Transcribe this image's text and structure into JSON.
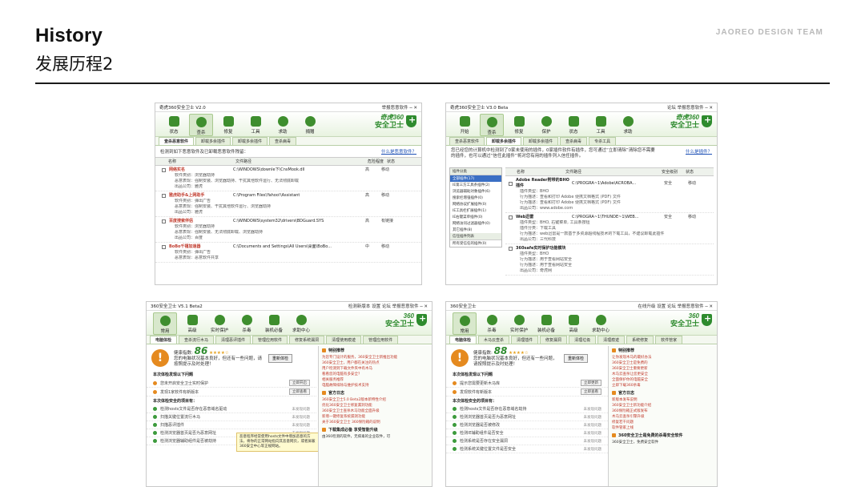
{
  "slide": {
    "title": "History",
    "subtitle": "发展历程2",
    "brand": "JAOREO DESIGN TEAM"
  },
  "colors": {
    "accent_green": "#2e8b2e",
    "warning_orange": "#e58a1f",
    "link_blue": "#1c4fb5",
    "alert_red": "#c0392b"
  },
  "shots": [
    {
      "window_title": "奇虎360安全卫士 V2.0",
      "window_controls": "举报恶意软件 ─ ✕",
      "toolbar": [
        {
          "label": "状态",
          "icon": "monitor-icon"
        },
        {
          "label": "查杀",
          "icon": "magnifier-icon"
        },
        {
          "label": "修复",
          "icon": "plus-box-icon"
        },
        {
          "label": "工具",
          "icon": "tools-icon"
        },
        {
          "label": "求助",
          "icon": "help-icon"
        },
        {
          "label": "捐赠",
          "icon": "gift-icon"
        }
      ],
      "logo_line1": "奇虎360",
      "logo_line2": "安全卫士",
      "tabs": [
        "查杀恶意软件",
        "卸载多余插件",
        "卸载多余插件",
        "查杀病毒"
      ],
      "info": "检测到如下恶意软件及已卸载恶意软件残留：",
      "info_link": "什么是恶意软件？",
      "columns": [
        "名称",
        "文件路径",
        "危险程度",
        "状态"
      ],
      "rows": [
        {
          "name": "网络实名",
          "path": "C:\\WINDOWS\\downle下\\CnsMook.dll",
          "lvl": "高",
          "st": "移动",
          "details": [
            "软件类别：浏览器劫持",
            "恶意表现：强制安装、浏览器劫持、干扰其他软件运行、无法彻底卸载",
            "出品公司：雅虎"
          ]
        },
        {
          "name": "雅虎助手&上网助手",
          "path": "C:\\Program Files\\Yahoo!\\Assistant",
          "lvl": "高",
          "st": "移动",
          "details": [
            "软件类别：弹出广告",
            "恶意表现：强制安装、干扰其他软件运行、浏览器劫持",
            "出品公司：雅虎"
          ]
        },
        {
          "name": "百度搜索伴侣",
          "path": "C:\\WINDOWS\\system32\\drivers\\BDGuard.SYS",
          "lvl": "高",
          "st": "有链接",
          "details": [
            "软件类别：浏览器劫持",
            "恶意表现：强制安装、无法彻底卸载、浏览器劫持",
            "出品公司：百度"
          ]
        },
        {
          "name": "BoBo千禧加速器",
          "path": "C:\\Documents and Settings\\All Users\\桌面\\BoBo...",
          "lvl": "中",
          "st": "移动",
          "details": [
            "软件类别：弹出广告",
            "恶意表现：恶意软件共享"
          ]
        }
      ]
    },
    {
      "window_title": "奇虎360安全卫士 V3.0 Beta",
      "window_controls": "论坛 举报恶意软件 ─ ✕",
      "toolbar": [
        {
          "label": "开始",
          "icon": "play-icon"
        },
        {
          "label": "查杀",
          "icon": "magnifier-icon"
        },
        {
          "label": "修复",
          "icon": "plus-box-icon"
        },
        {
          "label": "保护",
          "icon": "shield-icon"
        },
        {
          "label": "状态",
          "icon": "monitor-icon"
        },
        {
          "label": "工具",
          "icon": "tools-icon"
        },
        {
          "label": "求助",
          "icon": "help-icon"
        }
      ],
      "logo_line1": "奇虎360",
      "logo_line2": "安全卫士",
      "tabs": [
        "查杀恶意软件",
        "卸载多余插件",
        "卸载多余插件",
        "查杀病毒",
        "专杀工具"
      ],
      "info": "您已经您的计算机中检测到了0家未使用的插件，0家插件软件有插件，您可通过“立即清除”清除您不需要的插件，也可以通过“信任此插件”将对您有用的插件列入信任插件。",
      "info_link": "什么是插件？",
      "category_header": "插件分类",
      "categories": [
        "全部插件(17)",
        "IE第三方工具条插件(2)",
        "浏览器辅助对象插件(6)",
        "搜索栏增强插件(0)",
        "网络协议扩展插件(0)",
        "IE工具栏扩展插件(1)",
        "IE右键菜单插件(0)",
        "网络访问过滤器插件(0)",
        "其它插件(8)"
      ],
      "category_header2": "信任插件列表",
      "categories2": [
        "所有受信任的插件(0)"
      ],
      "columns": [
        "名称",
        "文件路径",
        "安全级别",
        "状态"
      ],
      "rows": [
        {
          "name": "Adobe Reader附带的BHO插件",
          "path": "C:\\PROGRA~1\\Adobe\\ACROBA...",
          "lvl": "安全",
          "st": "移动",
          "details": [
            "插件类型：BHO",
            "行为描述：查看和打印 Adobe 便携文档格式 (PDF) 文件",
            "行为描述：查看和打印 Adobe 便携文档格式 (PDF) 文件",
            "出品公司：www.adobe.com"
          ]
        },
        {
          "name": "Web迅雷",
          "path": "C:\\PROGRA~1\\THUNDE~1\\WEB...",
          "lvl": "安全",
          "st": "移动",
          "details": [
            "插件类型：BHO, 右键菜单, 工具条按钮",
            "插件分类：下载工具",
            "行为描述：web迅雷是一款基于多资源超线程技术的下载工具，不建议卸载此插件",
            "出品公司：三代科技"
          ]
        },
        {
          "name": "360safe实时保护功能模块",
          "path": "",
          "lvl": "",
          "st": "",
          "details": [
            "插件类型：BHO",
            "行为描述：用于查看网站安全",
            "行为描述：用于查看网站安全",
            "出品公司：奇虎网"
          ]
        }
      ]
    },
    {
      "window_title": "360安全卫士 V5.1 Beta2",
      "window_controls": "检测新版本 设置 论坛 举报恶意软件 ─ ✕",
      "toolbar": [
        {
          "label": "常用",
          "icon": "home-icon"
        },
        {
          "label": "高级",
          "icon": "grid-icon"
        },
        {
          "label": "实时保护",
          "icon": "shield-icon"
        },
        {
          "label": "杀毒",
          "icon": "scan-icon"
        },
        {
          "label": "装机必备",
          "icon": "box-icon"
        },
        {
          "label": "求助中心",
          "icon": "help-icon"
        }
      ],
      "logo_line1": "360",
      "logo_line2": "安全卫士",
      "tabs": [
        "电脑体检",
        "查杀流行木马",
        "清理恶评插件",
        "管理应用软件",
        "修复系统漏洞",
        "清理使用痕迹",
        "管理应用软件"
      ],
      "health_label": "健康指数:",
      "health_score": "86",
      "health_stars": "★★★★☆",
      "health_desc": "您的电脑状况基本良好，但还有一些问题，请按照提示及时处理！",
      "health_button": "重新体检",
      "section1": "本次体检发现以下问题",
      "issues": [
        {
          "text": "您未开启安全卫士实时保护",
          "action": "立即开启"
        },
        {
          "text": "发现1家软件有新版本",
          "action": "立即查看"
        }
      ],
      "section2": "本次体检安全的项目有：",
      "safe_items": [
        {
          "text": "检测hosts文件是否存在恶意域名驱动",
          "status": "未发现问题"
        },
        {
          "text": "扫描关键位置流行木马",
          "status": "未发现问题"
        },
        {
          "text": "扫描恶评插件",
          "status": "未发现问题"
        },
        {
          "text": "检测浏览器首页是否为恶意网址",
          "status": "未发现问题"
        },
        {
          "text": "检测浏览器辅助组件是否被劫持",
          "status": "未发现问题"
        }
      ],
      "tooltip": "恶意程序经常使用hosts文件中增加恶意的方法，将你的正常网站指向其恶意网页，或者屏蔽360安全中心等正规网站。",
      "side_head1": "特别推荐",
      "side_links": [
        "为您专门设计的服务，360安全卫士新推出功能",
        "360安全卫士，用户都在关注的热点",
        "用户检测到下载文件夹中有木马",
        "看看您的电脑有多安全？",
        "相关服务推荐",
        "电脑故障排除与维护技术支持"
      ],
      "side_head2": "官方日志",
      "side_logs": [
        "360安全卫士5.0 Beta2版本新特性介绍",
        "优化360安全卫士修复漏洞功能",
        "360安全卫士查杀木马功能全面升级",
        "新增一键修复系统漏洞功能",
        "关于360安全卫士 360保险箱的说明"
      ],
      "side_head3": "下载集成必备  享受智能升级",
      "side_foot": "由360检测的软件，无病毒的企业软件，可"
    },
    {
      "window_title": "360安全卫士",
      "window_controls": "在线升级 设置 论坛 举报恶意软件 ─ ✕",
      "toolbar": [
        {
          "label": "常用",
          "icon": "home-icon"
        },
        {
          "label": "杀毒",
          "icon": "scan-icon"
        },
        {
          "label": "实时保护",
          "icon": "shield-icon"
        },
        {
          "label": "装机必备",
          "icon": "box-icon"
        },
        {
          "label": "高级",
          "icon": "grid-icon"
        },
        {
          "label": "求助中心",
          "icon": "help-icon"
        }
      ],
      "logo_line1": "360",
      "logo_line2": "安全卫士",
      "tabs": [
        "电脑体检",
        "木马云查杀",
        "清理插件",
        "修复漏洞",
        "清理垃圾",
        "清理痕迹",
        "系统修复",
        "软件管家"
      ],
      "health_label": "健康指数:",
      "health_score": "88",
      "health_stars": "★★★★☆",
      "health_desc": "您的电脑状况基本良好，但还有一些问题，请按照提示及时处理！",
      "health_button": "重新体检",
      "section1": "本次体检发现以下问题",
      "issues": [
        {
          "text": "提示您需要更新木马库",
          "action": "立即更新"
        },
        {
          "text": "发现软件有新版本",
          "action": "立即查看"
        }
      ],
      "section2": "本次体检安全的项目有：",
      "safe_items": [
        {
          "text": "检测hosts文件是否存在恶意域名劫持",
          "status": "未发现问题"
        },
        {
          "text": "检测浏览器首页是否为恶意网址",
          "status": "未发现问题"
        },
        {
          "text": "检测浏览器是否被修改",
          "status": "未发现问题"
        },
        {
          "text": "检测IE辅助组件是否安全",
          "status": "未发现问题"
        },
        {
          "text": "检测系统是否存在安全漏洞",
          "status": "未发现问题"
        },
        {
          "text": "检测系统关键位置文件是否安全",
          "status": "未发现问题"
        }
      ],
      "side_head1": "特别推荐",
      "side_links": [
        "让你发现木马的最好办法",
        "360安全卫士是免费的",
        "360安全卫士重要更新",
        "木马云查杀让您更安全",
        "全面保护你的电脑安全",
        "立即下载360杀毒"
      ],
      "side_head2": "官方日志",
      "side_logs": [
        "新版本发布说明",
        "360安全卫士新功能介绍",
        "360保险箱正式版发布",
        "木马云查杀引擎升级",
        "修复若干问题",
        "软件管家上线"
      ],
      "side_head3": "360安全卫士是免费的杀毒安全软件",
      "side_foot": "360安全卫士，免费安全软件"
    }
  ]
}
